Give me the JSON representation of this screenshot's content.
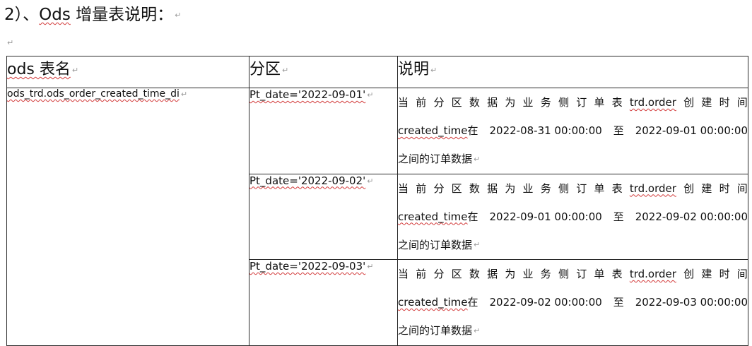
{
  "heading": {
    "prefix": "2）、",
    "ods": "Ods",
    "rest": " 增量表说明："
  },
  "para_mark": "↵",
  "table": {
    "headers": {
      "name": "ods 表名",
      "partition": "分区",
      "description": "说明"
    },
    "table_name": "ods_trd.ods_order_created_time_di",
    "rows": [
      {
        "partition": "Pt_date='2022-09-01'",
        "desc_chars": [
          "当",
          "前",
          "分",
          "区",
          "数",
          "据",
          "为",
          "业",
          "务",
          "侧",
          "订",
          "单",
          "表"
        ],
        "desc_table": "trd.order",
        "desc_tail": [
          "创",
          "建",
          "时",
          "间"
        ],
        "field": "created_time",
        "zai": "在",
        "start": "2022-08-31 00:00:00",
        "zhi": "至",
        "end": "2022-09-01 00:00:00",
        "line3": "之间的订单数据"
      },
      {
        "partition": "Pt_date='2022-09-02'",
        "desc_chars": [
          "当",
          "前",
          "分",
          "区",
          "数",
          "据",
          "为",
          "业",
          "务",
          "侧",
          "订",
          "单",
          "表"
        ],
        "desc_table": "trd.order",
        "desc_tail": [
          "创",
          "建",
          "时",
          "间"
        ],
        "field": "created_time",
        "zai": "在",
        "start": "2022-09-01 00:00:00",
        "zhi": "至",
        "end": "2022-09-02 00:00:00",
        "line3": "之间的订单数据"
      },
      {
        "partition": "Pt_date='2022-09-03'",
        "desc_chars": [
          "当",
          "前",
          "分",
          "区",
          "数",
          "据",
          "为",
          "业",
          "务",
          "侧",
          "订",
          "单",
          "表"
        ],
        "desc_table": "trd.order",
        "desc_tail": [
          "创",
          "建",
          "时",
          "间"
        ],
        "field": "created_time",
        "zai": "在",
        "start": "2022-09-02 00:00:00",
        "zhi": "至",
        "end": "2022-09-03 00:00:00",
        "line3": "之间的订单数据"
      }
    ]
  }
}
